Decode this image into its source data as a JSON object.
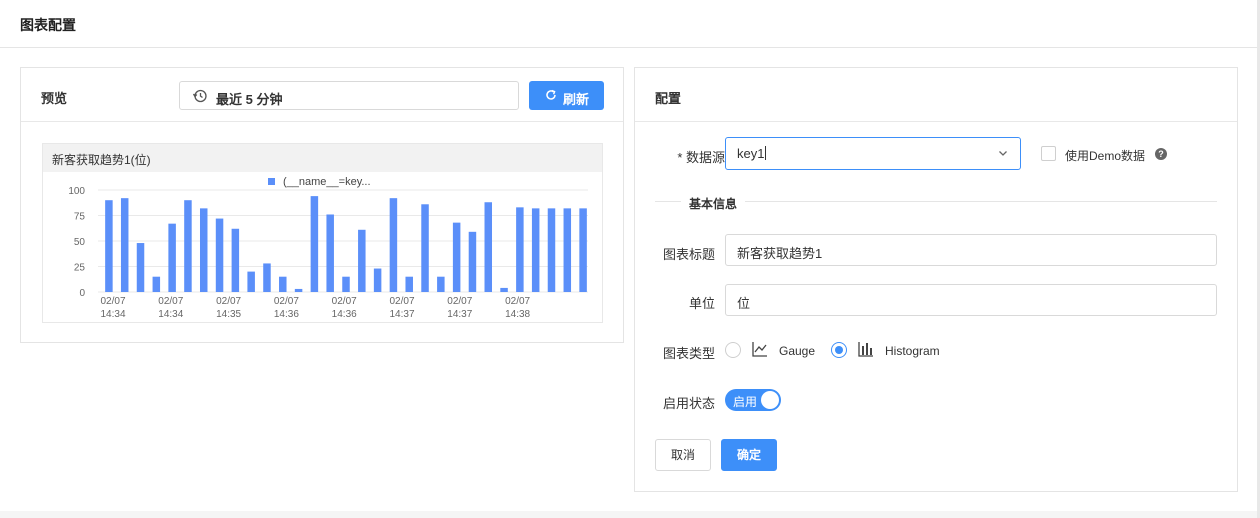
{
  "header": {
    "title": "图表配置"
  },
  "preview": {
    "label": "预览",
    "time_range": "最近 5 分钟",
    "time_icon": "history-clock-icon",
    "refresh_label": "刷新",
    "refresh_icon": "refresh-icon"
  },
  "chart": {
    "title": "新客获取趋势1(位)",
    "legend": "(__name__=key...",
    "accent_color": "#5b8ff9"
  },
  "chart_data": {
    "type": "bar",
    "title": "新客获取趋势1(位)",
    "ylim": [
      0,
      100
    ],
    "yticks": [
      "0",
      "25",
      "50",
      "75",
      "100"
    ],
    "xticks": [
      [
        "02/07",
        "14:34"
      ],
      [
        "02/07",
        "14:34"
      ],
      [
        "02/07",
        "14:35"
      ],
      [
        "02/07",
        "14:36"
      ],
      [
        "02/07",
        "14:36"
      ],
      [
        "02/07",
        "14:37"
      ],
      [
        "02/07",
        "14:37"
      ],
      [
        "02/07",
        "14:38"
      ]
    ],
    "series": [
      {
        "name": "(__name__=key...",
        "values": [
          90,
          92,
          48,
          15,
          67,
          90,
          82,
          72,
          62,
          20,
          28,
          15,
          3,
          94,
          76,
          15,
          61,
          23,
          92,
          15,
          86,
          15,
          68,
          59,
          88,
          4,
          83,
          82,
          82,
          82,
          82
        ]
      }
    ],
    "grid": true,
    "legend_position": "top-center"
  },
  "config": {
    "label": "配置",
    "datasource": {
      "label": "* 数据源",
      "value": "key1",
      "chevron_icon": "chevron-down-icon"
    },
    "demo_checkbox_label": "使用Demo数据",
    "help_icon": "?",
    "section_title": "基本信息",
    "chart_title": {
      "label": "图表标题",
      "value": "新客获取趋势1"
    },
    "unit": {
      "label": "单位",
      "value": "位"
    },
    "chart_type": {
      "label": "图表类型",
      "options": [
        {
          "label": "Gauge",
          "icon": "line-chart-icon",
          "selected": false
        },
        {
          "label": "Histogram",
          "icon": "bar-chart-icon",
          "selected": true
        }
      ]
    },
    "status": {
      "label": "启用状态",
      "switch_text": "启用",
      "on": true
    },
    "cancel_label": "取消",
    "ok_label": "确定"
  }
}
